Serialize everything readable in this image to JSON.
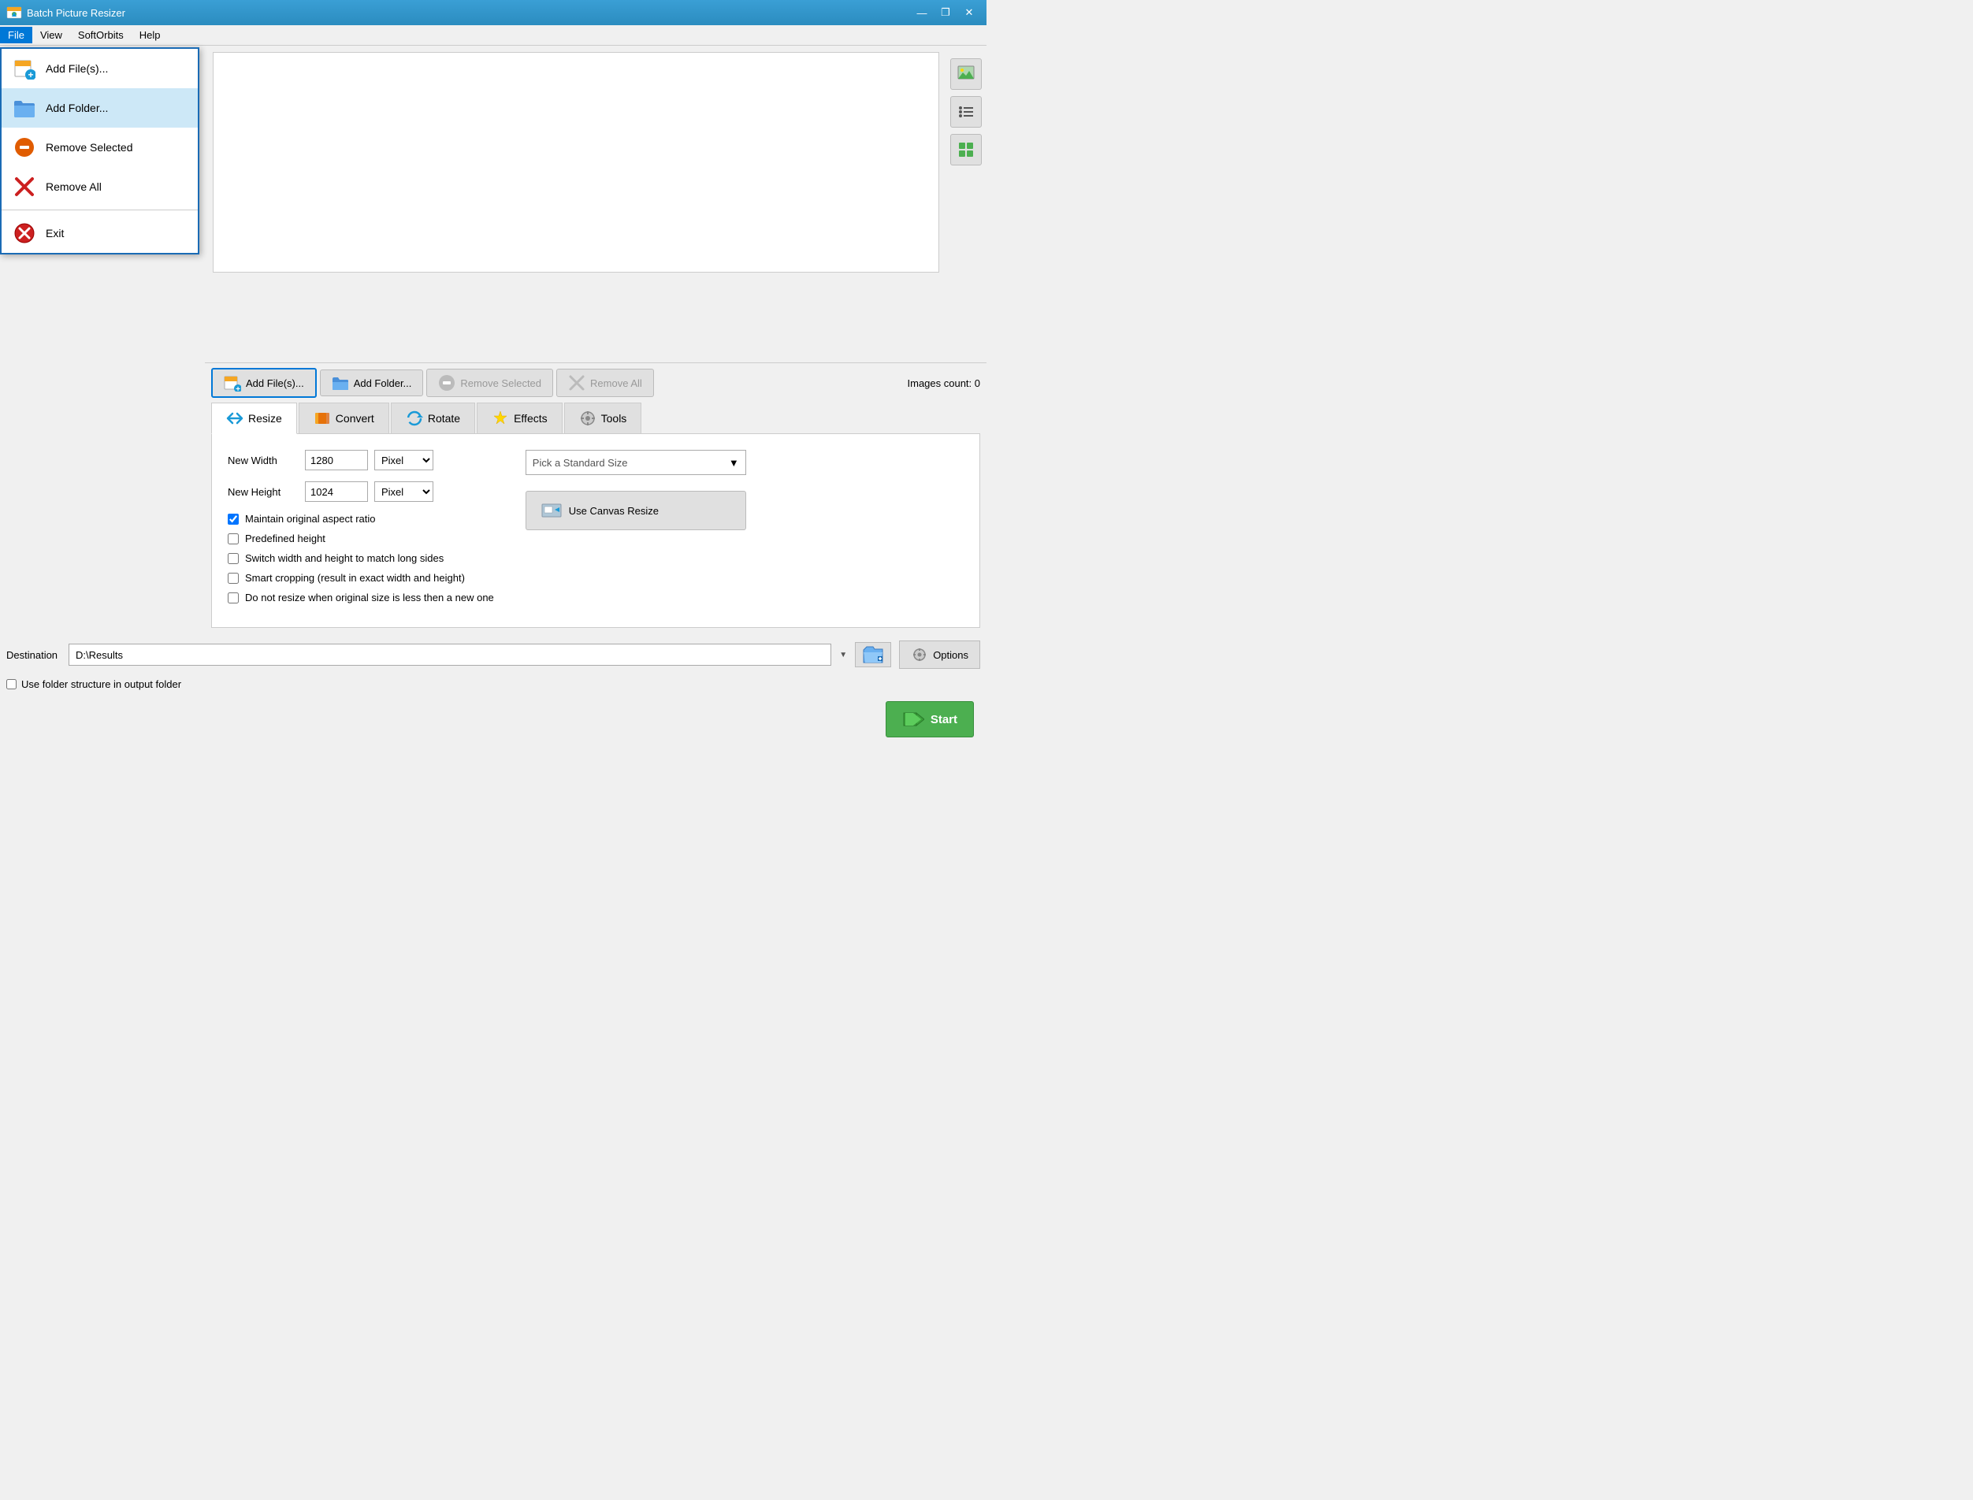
{
  "titleBar": {
    "title": "Batch Picture Resizer",
    "minBtn": "—",
    "maxBtn": "❐",
    "closeBtn": "✕"
  },
  "menuBar": {
    "items": [
      "File",
      "View",
      "SoftOrbits",
      "Help"
    ]
  },
  "dropdown": {
    "items": [
      {
        "id": "add-files",
        "label": "Add File(s)...",
        "icon": "file"
      },
      {
        "id": "add-folder",
        "label": "Add Folder...",
        "icon": "folder",
        "highlighted": true
      },
      {
        "id": "remove-selected",
        "label": "Remove Selected",
        "icon": "remove-selected"
      },
      {
        "id": "remove-all",
        "label": "Remove All",
        "icon": "remove-all"
      },
      {
        "id": "exit",
        "label": "Exit",
        "icon": "exit"
      }
    ]
  },
  "toolbar": {
    "addFiles": "Add File(s)...",
    "addFolder": "Add Folder...",
    "removeSelected": "Remove Selected",
    "removeAll": "Remove All",
    "imagesCount": "Images count: 0"
  },
  "tabs": [
    {
      "id": "resize",
      "label": "Resize",
      "icon": "↔"
    },
    {
      "id": "convert",
      "label": "Convert",
      "icon": "🔥"
    },
    {
      "id": "rotate",
      "label": "Rotate",
      "icon": "↻"
    },
    {
      "id": "effects",
      "label": "Effects",
      "icon": "✦"
    },
    {
      "id": "tools",
      "label": "Tools",
      "icon": "⚙"
    }
  ],
  "resizeTab": {
    "newWidthLabel": "New Width",
    "newWidth": "1280",
    "newHeightLabel": "New Height",
    "newHeight": "1024",
    "pixelOption": "Pixel",
    "standardSizePlaceholder": "Pick a Standard Size",
    "canvasBtnLabel": "Use Canvas Resize",
    "checkboxes": [
      {
        "id": "aspect-ratio",
        "label": "Maintain original aspect ratio",
        "checked": true
      },
      {
        "id": "predefined-height",
        "label": "Predefined height",
        "checked": false
      },
      {
        "id": "switch-sides",
        "label": "Switch width and height to match long sides",
        "checked": false
      },
      {
        "id": "smart-crop",
        "label": "Smart cropping (result in exact width and height)",
        "checked": false
      },
      {
        "id": "no-resize",
        "label": "Do not resize when original size is less then a new one",
        "checked": false
      }
    ]
  },
  "destination": {
    "label": "Destination",
    "value": "D:\\Results",
    "useFolderLabel": "Use folder structure in output folder"
  },
  "buttons": {
    "options": "Options",
    "start": "Start"
  },
  "sidebarIcons": [
    {
      "id": "image-view",
      "icon": "🖼"
    },
    {
      "id": "list-view",
      "icon": "≡"
    },
    {
      "id": "grid-view",
      "icon": "⊞"
    }
  ]
}
